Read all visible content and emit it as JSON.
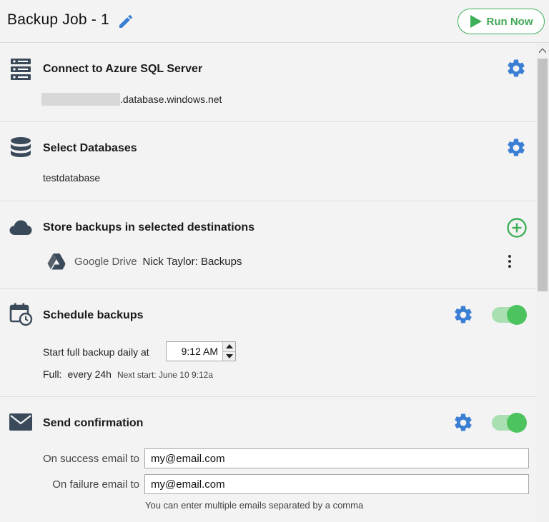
{
  "header": {
    "title": "Backup Job - 1",
    "run_label": "Run Now"
  },
  "server": {
    "title": "Connect to Azure SQL Server",
    "host_suffix": ".database.windows.net"
  },
  "databases": {
    "title": "Select Databases",
    "selected": "testdatabase"
  },
  "destinations": {
    "title": "Store backups in selected destinations",
    "items": [
      {
        "provider": "Google Drive",
        "name": "Nick Taylor: Backups"
      }
    ]
  },
  "schedule": {
    "title": "Schedule backups",
    "enabled": true,
    "start_label": "Start full backup daily at",
    "time": "9:12 AM",
    "full_label": "Full:",
    "full_value": "every 24h",
    "next_start": "Next start: June 10 9:12a"
  },
  "confirmation": {
    "title": "Send confirmation",
    "enabled": true,
    "success_label": "On success email to",
    "success_value": "my@email.com",
    "failure_label": "On failure email to",
    "failure_value": "my@email.com",
    "hint": "You can enter multiple emails separated by a comma"
  },
  "colors": {
    "accent_blue": "#3b7fd4",
    "success_green": "#3fb05a",
    "icon_dark": "#3a4a5a"
  },
  "icons": {
    "edit": "pencil-icon",
    "run": "play-icon",
    "server": "server-icon",
    "database": "database-icon",
    "cloud": "cloud-icon",
    "schedule": "calendar-clock-icon",
    "mail": "envelope-icon",
    "settings": "gear-icon",
    "add": "plus-circle-icon",
    "drive": "google-drive-icon",
    "more": "more-vertical-icon"
  }
}
